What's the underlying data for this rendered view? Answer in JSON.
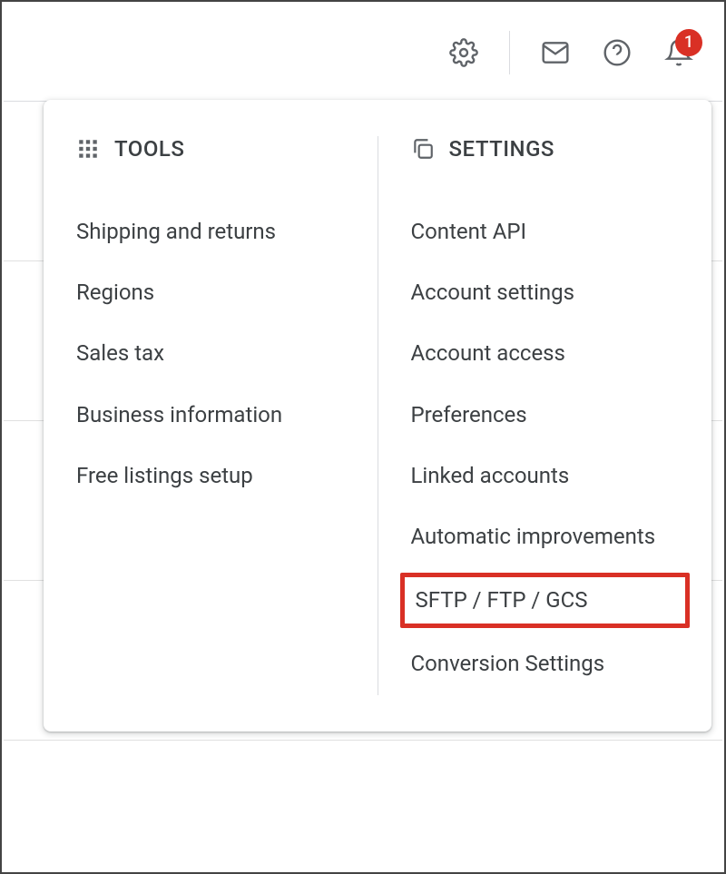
{
  "header": {
    "notification_count": "1"
  },
  "dropdown": {
    "tools": {
      "title": "TOOLS",
      "items": [
        "Shipping and returns",
        "Regions",
        "Sales tax",
        "Business information",
        "Free listings setup"
      ]
    },
    "settings": {
      "title": "SETTINGS",
      "items": [
        "Content API",
        "Account settings",
        "Account access",
        "Preferences",
        "Linked accounts",
        "Automatic improvements",
        "SFTP / FTP / GCS",
        "Conversion Settings"
      ]
    }
  }
}
